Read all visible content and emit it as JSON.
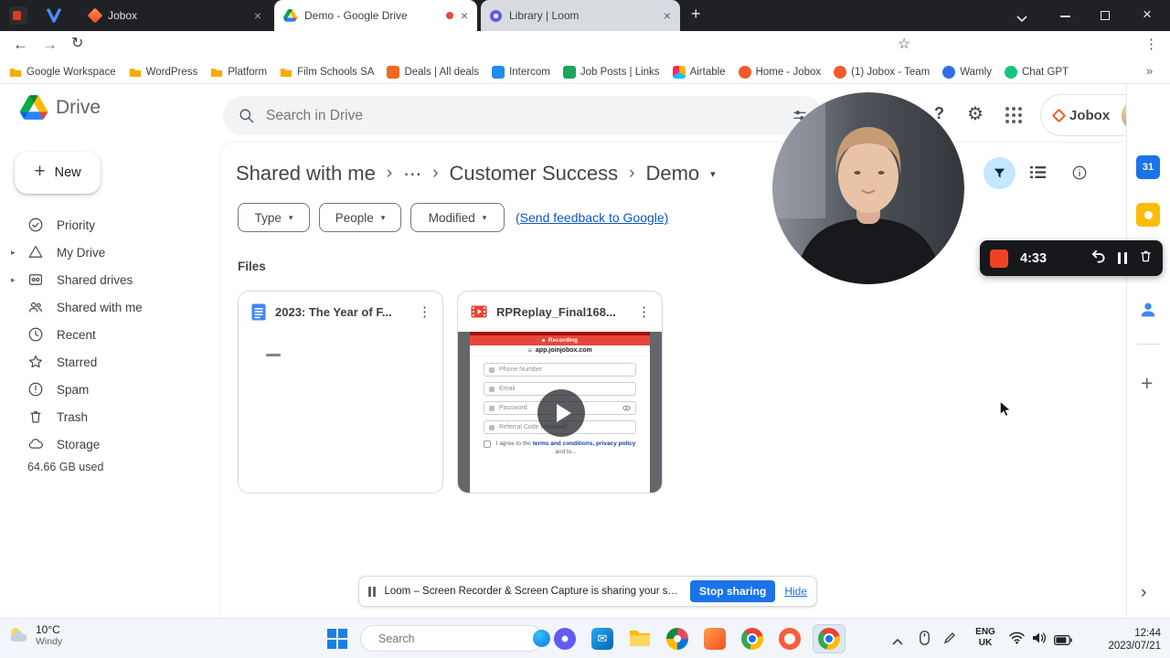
{
  "colors": {
    "accent_blue": "#1a73e8",
    "recording_red": "#e8453c",
    "loom_bar_bg": "#17181b",
    "filter_toggle_bg": "#c2e7ff"
  },
  "icons": {
    "plus": "+",
    "close": "×",
    "kebab": "⋮",
    "ellipsis": "⋯",
    "chevron_right": "›",
    "chevrons_right": "»",
    "caret_down": "▾",
    "caret_right": "▸",
    "star": "☆",
    "gear": "⚙",
    "reload": "↻",
    "back": "←",
    "forward": "→",
    "menu": "≡",
    "help": "?",
    "calendar_day": "31",
    "envelope": "✉"
  },
  "window": {
    "tabs": [
      "Jobox",
      "Demo - Google Drive",
      "Library | Loom"
    ],
    "url": "drive.google.com/drive/folders/1cDhaiSzIZG3a1C6dDYcUaQQLOHBH006r",
    "bookmarks": [
      "Google Workspace",
      "WordPress",
      "Platform",
      "Film Schools SA",
      "Deals | All deals",
      "Intercom",
      "Job Posts | Links",
      "Airtable",
      "Home - Jobox",
      "(1) Jobox - Team",
      "Wamly",
      "Chat GPT"
    ]
  },
  "drive": {
    "product_name": "Drive",
    "new_button": "New",
    "nav": [
      "Priority",
      "My Drive",
      "Shared drives",
      "Shared with me",
      "Recent",
      "Starred",
      "Spam",
      "Trash",
      "Storage"
    ],
    "storage_used": "64.66 GB used",
    "search_placeholder": "Search in Drive",
    "account_name": "Jobox",
    "breadcrumb": {
      "root": "Shared with me",
      "middle": "Customer Success",
      "current": "Demo"
    },
    "filter_chips": [
      "Type",
      "People",
      "Modified"
    ],
    "feedback_link": "(Send feedback to Google)",
    "section_label": "Files",
    "files": [
      {
        "name": "2023: The Year of F..."
      },
      {
        "name": "RPReplay_Final168..."
      }
    ],
    "video_thumb": {
      "banner": "Recording",
      "site": "app.joinjobox.com",
      "fields": [
        "Phone Number",
        "Email",
        "Password",
        "Referral Code (optional)"
      ],
      "agree_prefix": "I agree to the ",
      "agree_links": "terms and conditions, privacy policy",
      "agree_suffix": " and to..."
    }
  },
  "loom": {
    "timer": "4:33",
    "share_message": "Loom – Screen Recorder & Screen Capture is sharing your screen.",
    "stop_button": "Stop sharing",
    "hide_link": "Hide"
  },
  "taskbar": {
    "weather_temp": "10°C",
    "weather_desc": "Windy",
    "search_placeholder": "Search",
    "lang_top": "ENG",
    "lang_bottom": "UK",
    "clock_time": "12:44",
    "clock_date": "2023/07/21"
  }
}
